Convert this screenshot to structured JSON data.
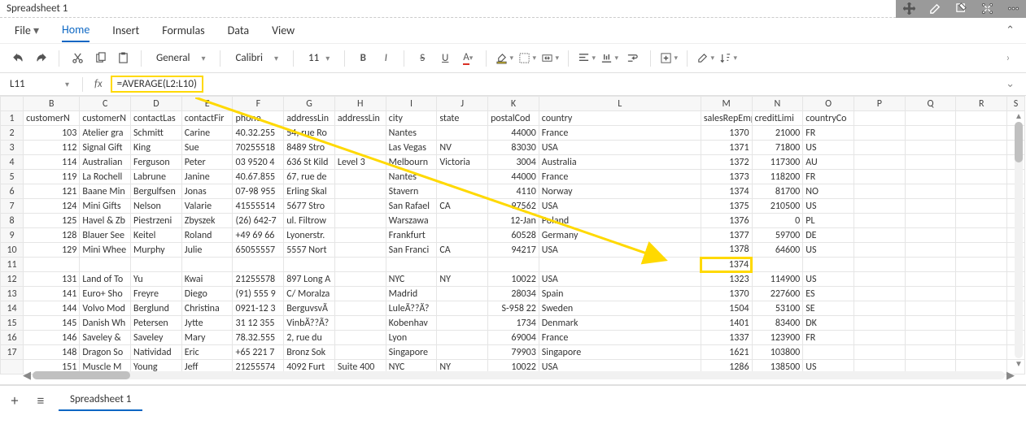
{
  "title": "Spreadsheet 1",
  "menu": {
    "file": "File",
    "home": "Home",
    "insert": "Insert",
    "formulas": "Formulas",
    "data": "Data",
    "view": "View"
  },
  "toolbar": {
    "number_format": "General",
    "font": "Calibri",
    "size": "11"
  },
  "formula": {
    "cell_ref": "L11",
    "fx": "fx",
    "value": "=AVERAGE(L2:L10)"
  },
  "headers": [
    "",
    "B",
    "C",
    "D",
    "E",
    "F",
    "G",
    "H",
    "I",
    "J",
    "K",
    "L",
    "M",
    "N",
    "O",
    "P",
    "Q",
    "R",
    "S"
  ],
  "row_labels": [
    "1",
    "2",
    "3",
    "4",
    "5",
    "6",
    "7",
    "8",
    "9",
    "10",
    "11",
    "12",
    "13",
    "14",
    "15",
    "16",
    "17"
  ],
  "header_row": [
    "customerN",
    "customerN",
    "contactLas",
    "contactFir",
    "phone",
    "addressLin",
    "addressLin",
    "city",
    "state",
    "postalCod",
    "country",
    "salesRepEmployeeNumber",
    "creditLimi",
    "countryCo",
    "",
    "",
    "",
    ""
  ],
  "rows": [
    [
      "103",
      "Atelier gra",
      "Schmitt",
      "Carine",
      "40.32.255",
      "54, rue Ro",
      "",
      "Nantes",
      "",
      "44000",
      "France",
      "1370",
      "21000",
      "FR",
      "",
      "",
      "",
      ""
    ],
    [
      "112",
      "Signal Gift",
      "King",
      "Sue",
      "70255518",
      "8489 Stro",
      "",
      "Las Vegas",
      "NV",
      "83030",
      "USA",
      "1371",
      "71800",
      "US",
      "",
      "",
      "",
      ""
    ],
    [
      "114",
      "Australian",
      "Ferguson",
      "Peter",
      "03 9520 4",
      "636 St Kild",
      "Level 3",
      "Melbourn",
      "Victoria",
      "3004",
      "Australia",
      "1372",
      "117300",
      "AU",
      "",
      "",
      "",
      ""
    ],
    [
      "119",
      "La Rochell",
      "Labrune",
      "Janine",
      "40.67.855",
      "67, rue de",
      "",
      "Nantes",
      "",
      "44000",
      "France",
      "1373",
      "118200",
      "FR",
      "",
      "",
      "",
      ""
    ],
    [
      "121",
      "Baane Min",
      "Bergulfsen",
      "Jonas",
      "07-98 955",
      "Erling Skal",
      "",
      "Stavern",
      "",
      "4110",
      "Norway",
      "1374",
      "81700",
      "NO",
      "",
      "",
      "",
      ""
    ],
    [
      "124",
      "Mini Gifts",
      "Nelson",
      "Valarie",
      "41555514",
      "5677 Stro",
      "",
      "San Rafael",
      "CA",
      "97562",
      "USA",
      "1375",
      "210500",
      "US",
      "",
      "",
      "",
      ""
    ],
    [
      "125",
      "Havel & Zb",
      "Piestrzeni",
      "Zbyszek",
      "(26) 642-7",
      "ul. Filtrow",
      "",
      "Warszawa",
      "",
      "12-Jan",
      "Poland",
      "1376",
      "0",
      "PL",
      "",
      "",
      "",
      ""
    ],
    [
      "128",
      "Blauer See",
      "Keitel",
      "Roland",
      "+49 69 66",
      "Lyonerstr.",
      "",
      "Frankfurt",
      "",
      "60528",
      "Germany",
      "1377",
      "59700",
      "DE",
      "",
      "",
      "",
      ""
    ],
    [
      "129",
      "Mini Whee",
      "Murphy",
      "Julie",
      "65055557",
      "5557 Nort",
      "",
      "San Franci",
      "CA",
      "94217",
      "USA",
      "1378",
      "64600",
      "US",
      "",
      "",
      "",
      ""
    ],
    [
      "",
      "",
      "",
      "",
      "",
      "",
      "",
      "",
      "",
      "",
      "",
      "1374",
      "",
      "",
      "",
      "",
      "",
      ""
    ],
    [
      "131",
      "Land of To",
      "Yu",
      "Kwai",
      "21255578",
      "897 Long A",
      "",
      "NYC",
      "NY",
      "10022",
      "USA",
      "1323",
      "114900",
      "US",
      "",
      "",
      "",
      ""
    ],
    [
      "141",
      "Euro+ Sho",
      "Freyre",
      "Diego",
      "(91) 555 9",
      "C/ Moralza",
      "",
      "Madrid",
      "",
      "28034",
      "Spain",
      "1370",
      "227600",
      "ES",
      "",
      "",
      "",
      ""
    ],
    [
      "144",
      "Volvo Mod",
      "Berglund",
      "Christina",
      "0921-12 3",
      "BerguvsvÃ",
      "",
      "LuleÃ??Ã?",
      "",
      "S-958 22",
      "Sweden",
      "1504",
      "53100",
      "SE",
      "",
      "",
      "",
      ""
    ],
    [
      "145",
      "Danish Wh",
      "Petersen",
      "Jytte",
      "31 12 355",
      "VinbÃ??Ã?",
      "",
      "Kobenhav",
      "",
      "1734",
      "Denmark",
      "1401",
      "83400",
      "DK",
      "",
      "",
      "",
      ""
    ],
    [
      "146",
      "Saveley &",
      "Saveley",
      "Mary",
      "78.32.555",
      "2, rue du",
      "",
      "Lyon",
      "",
      "69004",
      "France",
      "1337",
      "123900",
      "FR",
      "",
      "",
      "",
      ""
    ],
    [
      "148",
      "Dragon So",
      "Natividad",
      "Eric",
      "+65 221 7",
      "Bronz Sok",
      "",
      "Singapore",
      "",
      "79903",
      "Singapore",
      "1621",
      "103800",
      "",
      "",
      "",
      "",
      ""
    ],
    [
      "151",
      "Muscle M",
      "Young",
      "Jeff",
      "21255574",
      "4092 Furt",
      "Suite 400",
      "NYC",
      "NY",
      "10022",
      "USA",
      "1286",
      "138500",
      "US",
      "",
      "",
      "",
      ""
    ]
  ],
  "numeric_cols": [
    0,
    9,
    11,
    12
  ],
  "sheet_tab": "Spreadsheet 1"
}
